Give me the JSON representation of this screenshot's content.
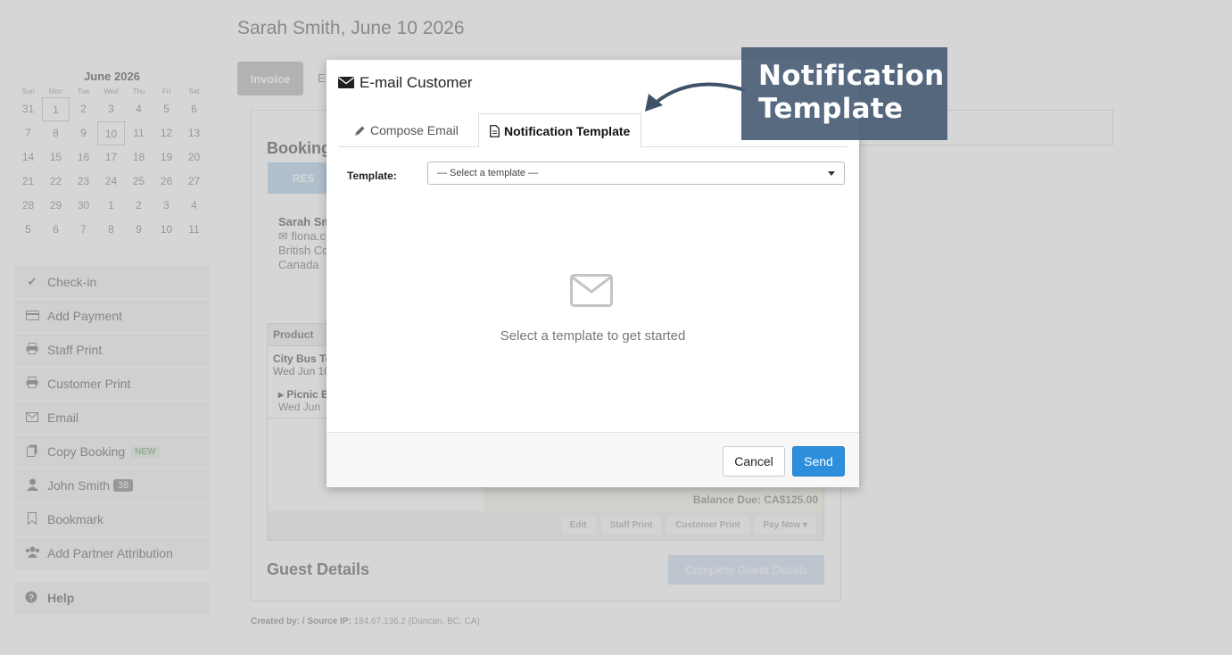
{
  "page": {
    "title": "Sarah Smith, June 10 2026",
    "invoice_tab": "Invoice",
    "second_tab_fragment": "E"
  },
  "calendar": {
    "month": "June 2026",
    "dows": [
      "Sun",
      "Mon",
      "Tue",
      "Wed",
      "Thu",
      "Fri",
      "Sat"
    ],
    "days": [
      "31",
      "1",
      "2",
      "3",
      "4",
      "5",
      "6",
      "7",
      "8",
      "9",
      "10",
      "11",
      "12",
      "13",
      "14",
      "15",
      "16",
      "17",
      "18",
      "19",
      "20",
      "21",
      "22",
      "23",
      "24",
      "25",
      "26",
      "27",
      "28",
      "29",
      "30",
      "1",
      "2",
      "3",
      "4",
      "5",
      "6",
      "7",
      "8",
      "9",
      "10",
      "11"
    ]
  },
  "sidebar": {
    "items": [
      {
        "label": "Check-in",
        "icon": "check-icon"
      },
      {
        "label": "Add Payment",
        "icon": "credit-card-icon"
      },
      {
        "label": "Staff Print",
        "icon": "print-icon"
      },
      {
        "label": "Customer Print",
        "icon": "print-icon"
      },
      {
        "label": "Email",
        "icon": "envelope-icon"
      },
      {
        "label": "Copy Booking",
        "icon": "copy-icon",
        "badge": "NEW"
      },
      {
        "label": "John Smith",
        "icon": "user-icon",
        "count": "38"
      },
      {
        "label": "Bookmark",
        "icon": "bookmark-icon"
      },
      {
        "label": "Add Partner Attribution",
        "icon": "users-icon"
      }
    ],
    "help": "Help"
  },
  "booking": {
    "heading": "Booking",
    "res_button": "RES",
    "customer": {
      "name": "Sarah Sm",
      "email": "fiona.c",
      "region": "British Co",
      "country": "Canada"
    },
    "products_header": "Product",
    "product_name": "City Bus To",
    "product_date": "Wed Jun 10",
    "addon_name": "Picnic B",
    "addon_date": "Wed Jun",
    "balance": "Balance Due:  CA$125.00",
    "actions": [
      "Edit",
      "Staff Print",
      "Customer Print",
      "Pay Now ▾"
    ]
  },
  "guest": {
    "heading": "Guest Details",
    "button": "Complete Guest Details"
  },
  "created": {
    "label": "Created by:",
    "mid": " / Source IP:",
    "value": " 184.67.136.2 (Duncan, BC, CA)"
  },
  "modal": {
    "title": "E-mail Customer",
    "tabs": [
      {
        "label": "Compose Email",
        "icon": "pencil-icon",
        "active": false
      },
      {
        "label": "Notification Template",
        "icon": "document-icon",
        "active": true
      }
    ],
    "template_label": "Template:",
    "template_placeholder": "— Select a template —",
    "empty_icon": "envelope-icon",
    "empty_text": "Select a template to get started",
    "cancel": "Cancel",
    "send": "Send"
  },
  "callout": {
    "line1": "Notification",
    "line2": "Template"
  },
  "colors": {
    "send": "#2d8fdb",
    "callout": "#4b5f76",
    "overlay": "#aaaaaa"
  }
}
